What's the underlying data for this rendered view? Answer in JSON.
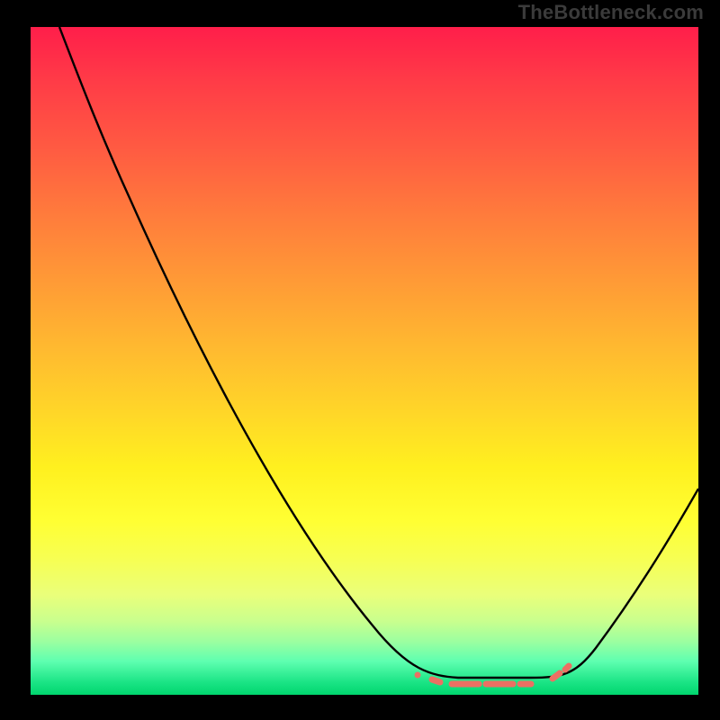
{
  "branding": {
    "watermark": "TheBottleneck.com"
  },
  "colors": {
    "frame_background": "#000000",
    "gradient_top": "#ff1e4a",
    "gradient_mid": "#fff01f",
    "gradient_bottom": "#00d66e",
    "curve": "#000000",
    "valley_markers": "#ec7063",
    "watermark_text": "#3b3b3b"
  },
  "chart_data": {
    "type": "line",
    "title": "",
    "xlabel": "",
    "ylabel": "",
    "x_range_pct": [
      0,
      100
    ],
    "y_range_pct": [
      0,
      100
    ],
    "description": "Bottleneck-style curve over a vertical red-to-green gradient. Y represents bottleneck percentage (100% top, 0% bottom). X is an unlabeled hardware-balance axis. The curve descends from top-left, flattens near zero around x≈60–80%, then rises toward the right edge.",
    "series": [
      {
        "name": "bottleneck_curve",
        "x_pct": [
          4,
          10,
          15,
          20,
          30,
          40,
          51,
          58,
          62,
          66,
          72,
          78,
          82,
          86,
          92,
          97,
          100
        ],
        "y_pct": [
          100,
          88,
          78,
          70,
          54,
          38,
          14,
          5,
          3,
          2,
          2,
          2,
          4,
          8,
          18,
          26,
          31
        ]
      }
    ],
    "valley_region_x_pct": [
      58,
      82
    ],
    "annotations": [
      {
        "name": "valley_markers",
        "kind": "dotted_segment",
        "color": "#ec7063",
        "x_pct_range": [
          58,
          82
        ],
        "y_pct_approx": 2
      }
    ]
  }
}
